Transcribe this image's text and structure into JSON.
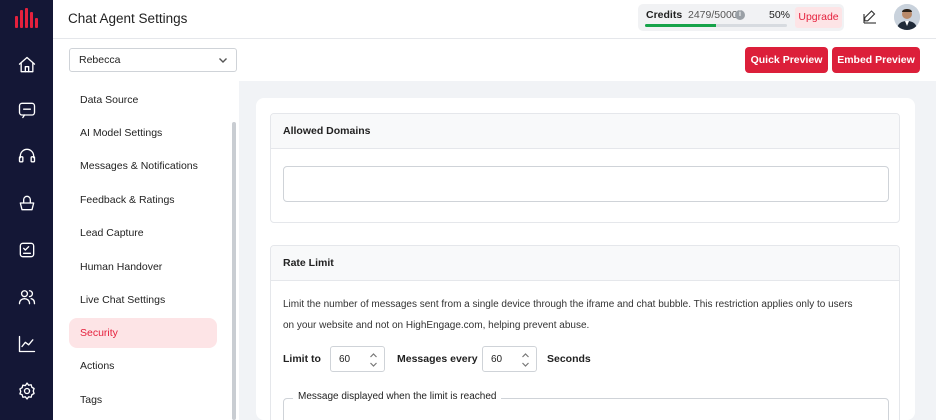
{
  "header": {
    "title": "Chat Agent Settings",
    "credits_label": "Credits",
    "credits_value": "2479/5000",
    "credits_percent": "50%",
    "credits_fraction": 0.5,
    "upgrade_label": "Upgrade"
  },
  "agent_select": {
    "value": "Rebecca"
  },
  "actions": {
    "quick_preview": "Quick Preview",
    "embed_preview": "Embed Preview"
  },
  "sidebar": {
    "items": [
      {
        "label": "Data Source"
      },
      {
        "label": "AI Model Settings"
      },
      {
        "label": "Messages & Notifications"
      },
      {
        "label": "Feedback & Ratings"
      },
      {
        "label": "Lead Capture"
      },
      {
        "label": "Human Handover"
      },
      {
        "label": "Live Chat Settings"
      },
      {
        "label": "Security",
        "active": true
      },
      {
        "label": "Actions"
      },
      {
        "label": "Tags"
      }
    ]
  },
  "allowed_domains": {
    "title": "Allowed Domains",
    "value": ""
  },
  "rate_limit": {
    "title": "Rate Limit",
    "description_line1": "Limit the number of messages sent from a single device through the iframe and chat bubble. This restriction applies only to users",
    "description_line2": "on your website and not on HighEngage.com, helping prevent abuse.",
    "limit_to_label": "Limit to",
    "limit_to_value": "60",
    "messages_every_label": "Messages every",
    "messages_every_value": "60",
    "seconds_label": "Seconds",
    "message_legend": "Message displayed when the limit is reached"
  },
  "colors": {
    "accent": "#e5213d",
    "rail": "#141736",
    "progress": "#16a34a"
  }
}
